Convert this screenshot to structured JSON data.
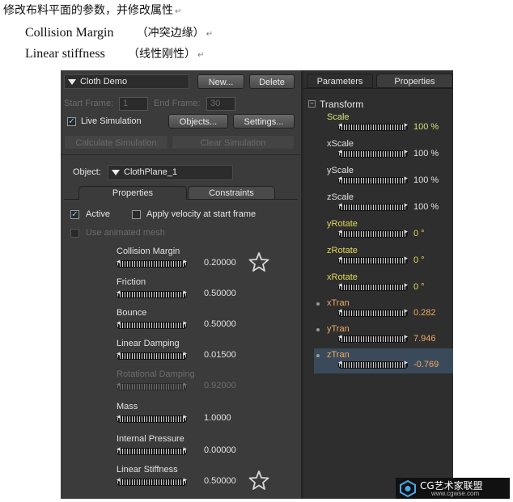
{
  "doc": {
    "line1": "修改布料平面的参数，并修改属性",
    "line2_en": "Collision Margin",
    "line2_cn": "（冲突边缘）",
    "line3_en": "Linear stiffness",
    "line3_cn": "（线性刚性）",
    "return_mark": "↵"
  },
  "cloth": {
    "title": "Cloth Demo",
    "new_label": "New...",
    "delete_label": "Delete",
    "start_frame_label": "Start Frame:",
    "start_frame_value": "1",
    "end_frame_label": "End Frame:",
    "end_frame_value": "30",
    "live_simulation_label": "Live Simulation",
    "objects_label": "Objects...",
    "settings_label": "Settings...",
    "calculate_label": "Calculate Simulation",
    "clear_label": "Clear Simulation",
    "object_label": "Object:",
    "object_value": "ClothPlane_1",
    "tabs": [
      "Properties",
      "Constraints"
    ],
    "active_label": "Active",
    "apply_velocity_label": "Apply velocity at start frame",
    "use_animated_label": "Use animated mesh",
    "params": [
      {
        "label": "Collision Margin",
        "value": "0.20000",
        "enabled": true,
        "starred": true
      },
      {
        "label": "Friction",
        "value": "0.50000",
        "enabled": true,
        "starred": false
      },
      {
        "label": "Bounce",
        "value": "0.50000",
        "enabled": true,
        "starred": false
      },
      {
        "label": "Linear Damping",
        "value": "0.01500",
        "enabled": true,
        "starred": false
      },
      {
        "label": "Rotational Damping",
        "value": "0.92000",
        "enabled": false,
        "starred": false
      },
      {
        "label": "Mass",
        "value": "1.0000",
        "enabled": true,
        "starred": false
      },
      {
        "label": "Internal Pressure",
        "value": "0.00000",
        "enabled": true,
        "starred": false
      },
      {
        "label": "Linear Stiffness",
        "value": "0.50000",
        "enabled": true,
        "starred": true
      }
    ]
  },
  "panel": {
    "tabs": [
      "Parameters",
      "Properties"
    ],
    "section_toggle": "–",
    "section_title": "Transform",
    "rows": [
      {
        "label": "Scale",
        "value": "100 %",
        "label_color": "#d6e27a",
        "value_color": "#c9e07a",
        "dot": false,
        "highlight": false
      },
      {
        "label": "xScale",
        "value": "100 %",
        "label_color": "#e0e0e0",
        "value_color": "#e0e0e0",
        "dot": false,
        "highlight": false
      },
      {
        "label": "yScale",
        "value": "100 %",
        "label_color": "#e0e0e0",
        "value_color": "#e0e0e0",
        "dot": false,
        "highlight": false
      },
      {
        "label": "zScale",
        "value": "100 %",
        "label_color": "#e0e0e0",
        "value_color": "#e0e0e0",
        "dot": false,
        "highlight": false
      },
      {
        "label": "yRotate",
        "value": "0 °",
        "label_color": "#e3d85a",
        "value_color": "#e3d85a",
        "dot": false,
        "highlight": false
      },
      {
        "label": "zRotate",
        "value": "0 °",
        "label_color": "#e3d85a",
        "value_color": "#e3d85a",
        "dot": false,
        "highlight": false
      },
      {
        "label": "xRotate",
        "value": "0 °",
        "label_color": "#e3d85a",
        "value_color": "#e3d85a",
        "dot": false,
        "highlight": false
      },
      {
        "label": "xTran",
        "value": "0.282",
        "label_color": "#f0a860",
        "value_color": "#f0a860",
        "dot": true,
        "highlight": false
      },
      {
        "label": "yTran",
        "value": "7.946",
        "label_color": "#f0a860",
        "value_color": "#f0a860",
        "dot": true,
        "highlight": false
      },
      {
        "label": "zTran",
        "value": "-0.769",
        "label_color": "#f0a860",
        "value_color": "#f0a860",
        "dot": true,
        "highlight": true
      }
    ]
  },
  "watermark": {
    "name": "CG艺术家联盟",
    "url": "www.cgwse.com"
  }
}
